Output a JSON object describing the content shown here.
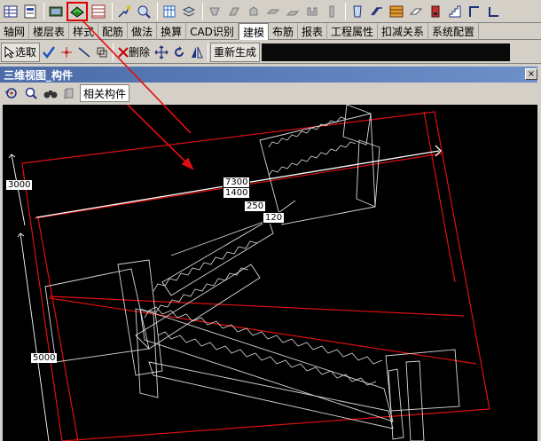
{
  "toolbar": {
    "icons": [
      "table-icon",
      "properties-icon",
      "view-icon",
      "3d-view-icon",
      "grid-icon",
      "draw-icon",
      "zoom-icon",
      "layer-icon",
      "stack-icon",
      "shape1-icon",
      "shape2-icon",
      "shape3-icon",
      "shape4-icon",
      "shape5-icon",
      "shape6-icon",
      "shape7-icon",
      "column-icon",
      "beam-icon",
      "slab-icon",
      "eraser-icon",
      "wall-icon",
      "stair-icon",
      "corner-icon",
      "more-icon"
    ]
  },
  "tabs": [
    {
      "label": "轴网"
    },
    {
      "label": "楼层表"
    },
    {
      "label": "样式"
    },
    {
      "label": "配筋"
    },
    {
      "label": "做法"
    },
    {
      "label": "换算"
    },
    {
      "label": "CAD识别"
    },
    {
      "label": "建模",
      "selected": true
    },
    {
      "label": "布筋"
    },
    {
      "label": "报表"
    },
    {
      "label": "工程属性"
    },
    {
      "label": "扣减关系"
    },
    {
      "label": "系统配置"
    }
  ],
  "command_bar": {
    "select_label": "选取",
    "delete_label": "删除",
    "regenerate_label": "重新生成"
  },
  "view_panel": {
    "title": "三维视图_构件",
    "close_glyph": "×",
    "related_label": "相关构件"
  },
  "drawing": {
    "dimensions": [
      "7300",
      "1400",
      "250",
      "120"
    ],
    "side_labels": [
      "3000",
      "5000"
    ],
    "colors": {
      "outline": "#e01010",
      "structure": "#d8d8d8",
      "arrow": "#e01010"
    }
  }
}
